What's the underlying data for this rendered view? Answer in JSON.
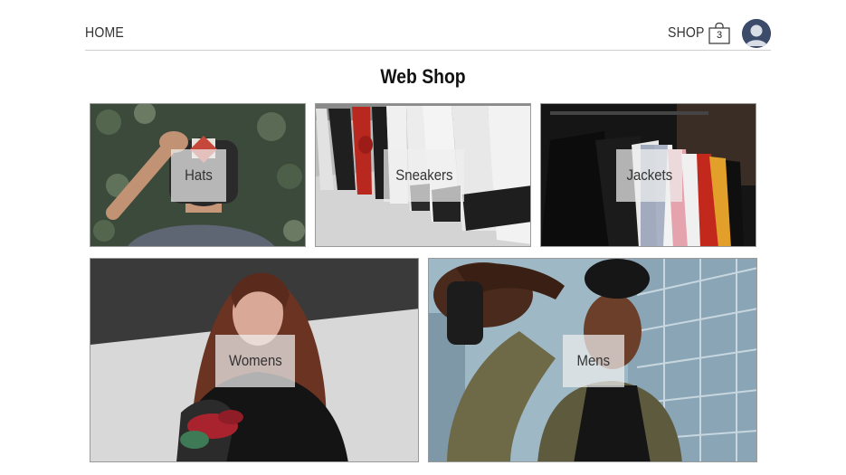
{
  "nav": {
    "home_label": "HOME",
    "shop_label": "SHOP",
    "cart_count": "3",
    "cart_icon": "shopping-bag-icon",
    "avatar_icon": "user-avatar-icon"
  },
  "page": {
    "title": "Web Shop"
  },
  "categories": [
    {
      "label": "Hats"
    },
    {
      "label": "Sneakers"
    },
    {
      "label": "Jackets"
    },
    {
      "label": "Womens"
    },
    {
      "label": "Mens"
    }
  ],
  "colors": {
    "avatar_bg": "#3d4b6b",
    "label_overlay": "#eeeeee",
    "divider": "#cfcfcf"
  }
}
